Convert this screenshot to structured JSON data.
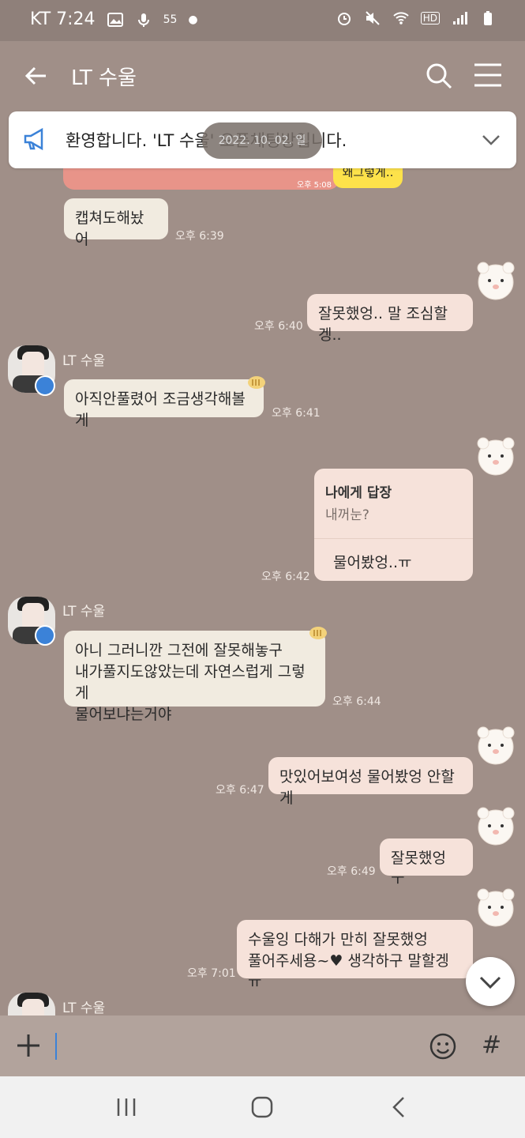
{
  "status_bar": {
    "carrier_time": "KT 7:24",
    "battery_hint": "55"
  },
  "header": {
    "title": "LT 수울"
  },
  "notice": {
    "text": "환영합니다. 'LT 수울' 오픈채팅방입니다.",
    "date_overlay": "2022. 10. 02. 일"
  },
  "partial": {
    "yellow_text": "왜그렇게..",
    "time": "오후 5:08"
  },
  "messages": [
    {
      "side": "in",
      "text": "캡쳐도해놨어",
      "time": "오후 6:39"
    },
    {
      "side": "out",
      "text": "잘못했엉.. 말 조심할겡..",
      "time": "오후 6:40"
    },
    {
      "side": "in",
      "sender": "LT 수울",
      "text": "아직안풀렸어 조금생각해볼게",
      "time": "오후 6:41"
    },
    {
      "side": "out",
      "reply_title": "나에게 답장",
      "reply_quote": "내꺼눈?",
      "text": "물어봤엉..ㅠ",
      "time": "오후 6:42"
    },
    {
      "side": "in",
      "sender": "LT 수울",
      "lines": [
        "아니 그러니깐 그전에 잘못해놓구",
        "내가풀지도않았는데 자연스럽게 그렇게",
        "물어보냐는거야"
      ],
      "time": "오후 6:44"
    },
    {
      "side": "out",
      "text": "맛있어보여성 물어봤엉 안할게",
      "time": "오후 6:47"
    },
    {
      "side": "out",
      "text": "잘못했엉 ㅜ",
      "time": "오후 6:49"
    },
    {
      "side": "out",
      "lines": [
        "수울잉 다해가 만히 잘못했엉",
        "풀어주세용~♥ 생각하구 말할겡 ㅠ"
      ],
      "time": "오후 7:01"
    },
    {
      "side": "in",
      "sender": "LT 수울"
    }
  ],
  "input": {
    "placeholder": ""
  },
  "colors": {
    "background": "#a08f88",
    "bubble_in": "#f1ebe0",
    "bubble_out": "#f6e2da",
    "accent": "#3b82d8"
  }
}
